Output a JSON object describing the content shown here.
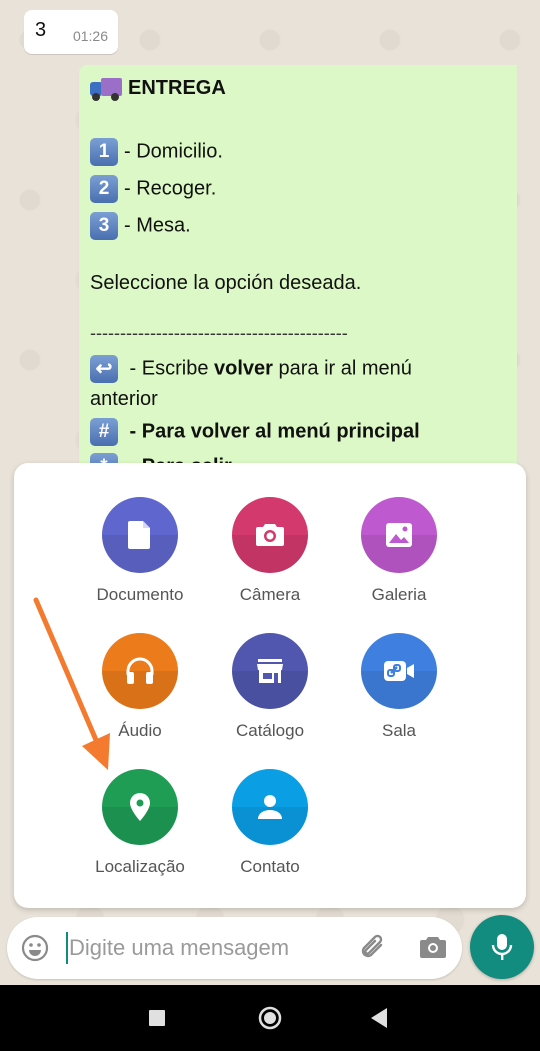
{
  "chat": {
    "incoming": {
      "text": "3",
      "time": "01:26"
    },
    "outgoing": {
      "title": "ENTREGA",
      "options": [
        {
          "num": "1",
          "text": "-  Domicilio."
        },
        {
          "num": "2",
          "text": "-  Recoger."
        },
        {
          "num": "3",
          "text": "-  Mesa."
        }
      ],
      "prompt": "Seleccione la opción deseada.",
      "divider": "-------------------------------------------",
      "back_prefix": " - Escribe ",
      "back_bold": "volver",
      "back_suffix": " para ir al menú",
      "back_line2": "anterior",
      "hash_text": " - Para volver al menú principal",
      "exit_text": " - Para salir"
    }
  },
  "attach_menu": {
    "items": [
      {
        "label": "Documento",
        "icon": "document-icon",
        "color": "#5f66cd"
      },
      {
        "label": "Câmera",
        "icon": "camera-icon",
        "color": "#d3396d"
      },
      {
        "label": "Galeria",
        "icon": "gallery-icon",
        "color": "#bf59cf"
      },
      {
        "label": "Áudio",
        "icon": "headphones-icon",
        "color": "#ec7b1c"
      },
      {
        "label": "Catálogo",
        "icon": "store-icon",
        "color": "#5157ae"
      },
      {
        "label": "Sala",
        "icon": "video-link-icon",
        "color": "#3f7fe0"
      },
      {
        "label": "Localização",
        "icon": "location-pin-icon",
        "color": "#1f9d55"
      },
      {
        "label": "Contato",
        "icon": "person-icon",
        "color": "#0a9ee5"
      }
    ]
  },
  "composer": {
    "placeholder": "Digite uma mensagem"
  },
  "colors": {
    "accent": "#128c7e",
    "outgoing_bubble": "#dcf8c6",
    "arrow": "#f47a2f"
  }
}
